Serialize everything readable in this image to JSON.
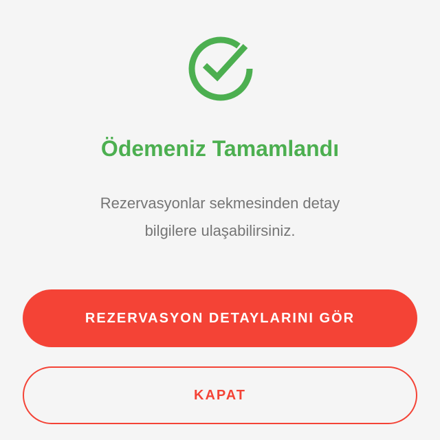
{
  "colors": {
    "success": "#4caf50",
    "accent": "#f44336",
    "text_secondary": "#757575",
    "background": "#f5f5f5"
  },
  "success_icon": "check-circle-icon",
  "title": "Ödemeniz Tamamlandı",
  "message": {
    "line1": "Rezervasyonlar sekmesinden detay",
    "line2": "bilgilere ulaşabilirsiniz."
  },
  "buttons": {
    "primary_label": "REZERVASYON DETAYLARINI GÖR",
    "secondary_label": "KAPAT"
  }
}
